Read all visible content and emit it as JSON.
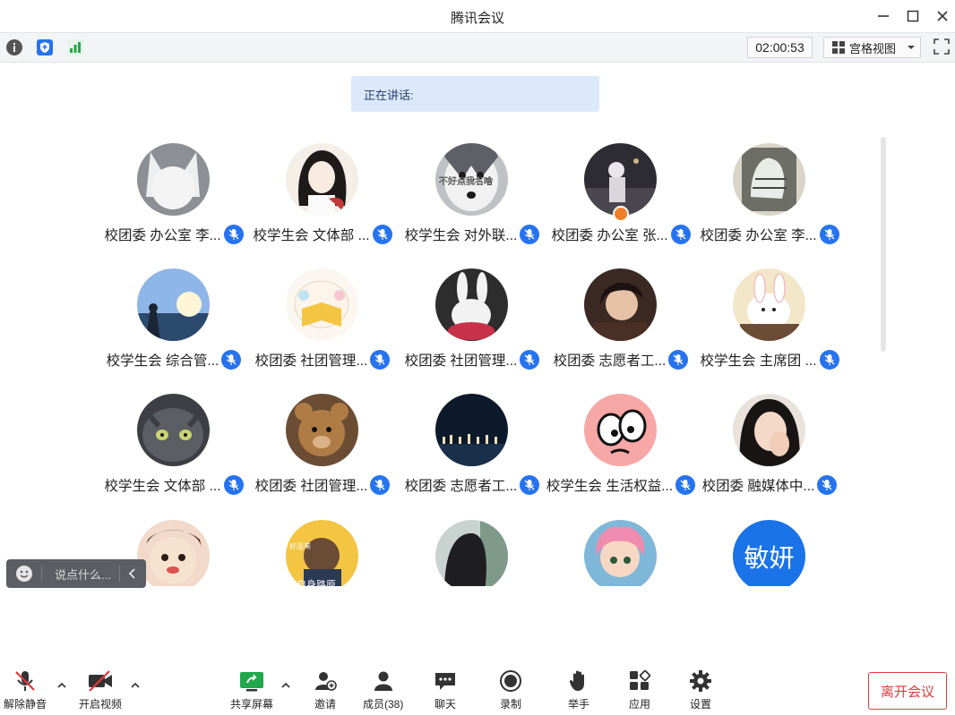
{
  "window": {
    "title": "腾讯会议"
  },
  "toolbar": {
    "timer": "02:00:53",
    "view_label": "宫格视图"
  },
  "speaking": {
    "label": "正在讲话:"
  },
  "participants": [
    {
      "name": "校团委 办公室 李...",
      "host": false
    },
    {
      "name": "校学生会 文体部 ...",
      "host": false
    },
    {
      "name": "校学生会 对外联...",
      "host": false
    },
    {
      "name": "校团委 办公室 张...",
      "host": true
    },
    {
      "name": "校团委 办公室 李...",
      "host": false
    },
    {
      "name": "校学生会 综合管...",
      "host": false
    },
    {
      "name": "校团委 社团管理...",
      "host": false
    },
    {
      "name": "校团委 社团管理...",
      "host": false
    },
    {
      "name": "校团委 志愿者工...",
      "host": false
    },
    {
      "name": "校学生会 主席团 ...",
      "host": false
    },
    {
      "name": "校学生会 文体部 ...",
      "host": false
    },
    {
      "name": "校团委 社团管理...",
      "host": false
    },
    {
      "name": "校团委 志愿者工...",
      "host": false
    },
    {
      "name": "校学生会 生活权益...",
      "host": false
    },
    {
      "name": "校团委 融媒体中...",
      "host": false
    }
  ],
  "avatar_texts": {
    "row3_tile2_top": "好运来",
    "row3_tile2_bottom": "自身路原",
    "text_avatar": "敏妍",
    "row0_tile2": "不好点我名啥"
  },
  "chat": {
    "placeholder": "说点什么..."
  },
  "bottom_bar": {
    "mute": "解除静音",
    "video": "开启视频",
    "share": "共享屏幕",
    "invite": "邀请",
    "members": "成员(38)",
    "chat": "聊天",
    "record": "录制",
    "raise_hand": "举手",
    "apps": "应用",
    "settings": "设置",
    "leave": "离开会议"
  },
  "colors": {
    "accent": "#2673f0",
    "leave": "#e0393e",
    "speaking_bg": "#dce8fb"
  }
}
